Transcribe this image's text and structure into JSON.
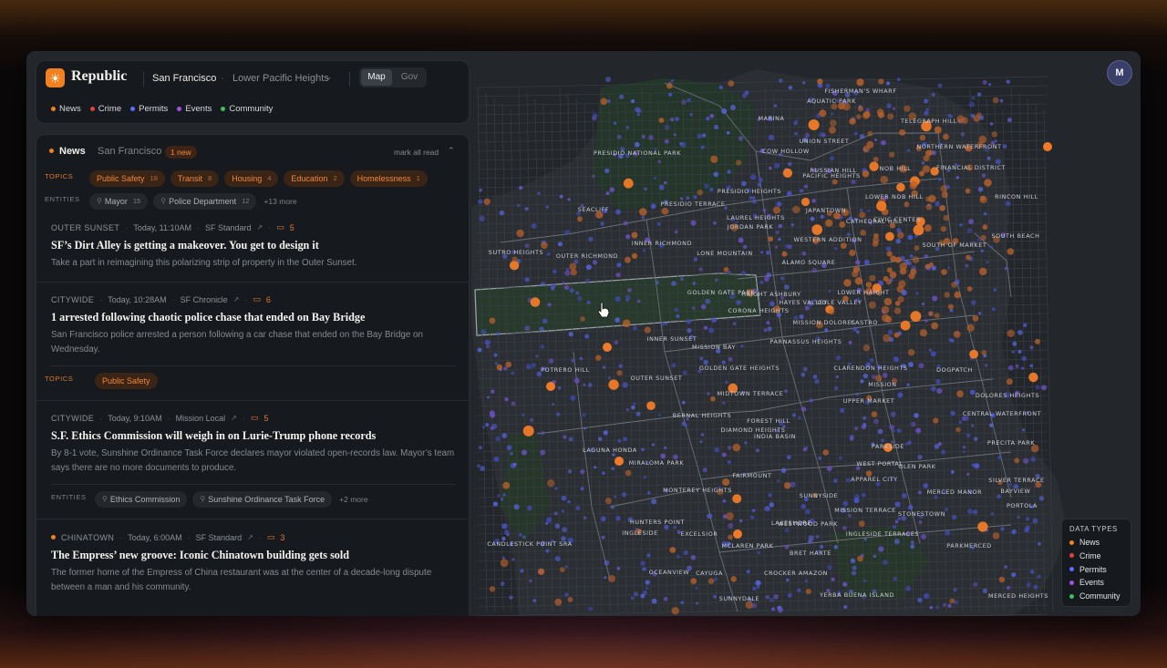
{
  "header": {
    "brand": "Republic",
    "city": "San Francisco",
    "neighborhood": "Lower Pacific Heights",
    "view_tabs": [
      "Map",
      "Gov"
    ],
    "active_tab": "Map",
    "filters": [
      {
        "label": "News",
        "color": "#f08020"
      },
      {
        "label": "Crime",
        "color": "#e04040"
      },
      {
        "label": "Permits",
        "color": "#5a6cff"
      },
      {
        "label": "Events",
        "color": "#a050e8"
      },
      {
        "label": "Community",
        "color": "#3cc060"
      }
    ]
  },
  "feed": {
    "title": "News",
    "city": "San Francisco",
    "new_badge": "1 new",
    "mark_all_read": "mark all read",
    "topics_label": "TOPICS",
    "entities_label": "ENTITIES",
    "topics": [
      {
        "label": "Public Safety",
        "count": "18"
      },
      {
        "label": "Transit",
        "count": "8"
      },
      {
        "label": "Housing",
        "count": "4"
      },
      {
        "label": "Education",
        "count": "2"
      },
      {
        "label": "Homelessness",
        "count": "1"
      }
    ],
    "entities": [
      {
        "label": "Mayor",
        "count": "15"
      },
      {
        "label": "Police Department",
        "count": "12"
      }
    ],
    "entities_more": "+13 more",
    "articles": [
      {
        "location": "OUTER SUNSET",
        "time": "Today, 11:10AM",
        "source": "SF Standard",
        "comments": "5",
        "headline": "SF’s Dirt Alley is getting a makeover. You get to design it",
        "description": "Take a part in reimagining this polarizing strip of property in the Outer Sunset."
      },
      {
        "location": "CITYWIDE",
        "time": "Today, 10:28AM",
        "source": "SF Chronicle",
        "comments": "6",
        "headline": "1 arrested following chaotic police chase that ended on Bay Bridge",
        "description": "San Francisco police arrested a person following a car chase that ended on the Bay Bridge on Wednesday.",
        "topics_label": "TOPICS",
        "topics": [
          "Public Safety"
        ]
      },
      {
        "location": "CITYWIDE",
        "time": "Today, 9:10AM",
        "source": "Mission Local",
        "comments": "5",
        "headline": "S.F. Ethics Commission will weigh in on Lurie-Trump phone records",
        "description": "By 8-1 vote, Sunshine Ordinance Task Force declares mayor violated open-records law. Mayor’s team says there are no more documents to produce.",
        "entities_label": "ENTITIES",
        "entities": [
          "Ethics Commission",
          "Sunshine Ordinance Task Force"
        ],
        "entities_more": "+2 more"
      },
      {
        "location": "CHINATOWN",
        "time": "Today, 6:00AM",
        "source": "SF Standard",
        "comments": "3",
        "headline": "The Empress’ new groove: Iconic Chinatown building gets sold",
        "description": "The former home of the Empress of China restaurant was at the center of a decade-long dispute between a man and his community."
      }
    ]
  },
  "map": {
    "neighborhoods": [
      "FISHERMAN'S WHARF",
      "AQUATIC PARK",
      "TELEGRAPH HILL",
      "MARINA",
      "PRESIDIO NATIONAL PARK",
      "COW HOLLOW",
      "UNION STREET",
      "NORTHERN WATERFRONT",
      "RUSSIAN HILL",
      "NOB HILL",
      "FINANCIAL DISTRICT",
      "PACIFIC HEIGHTS",
      "SEACLIFF",
      "PRESIDIO TERRACE",
      "PRESIDIO HEIGHTS",
      "LAUREL HEIGHTS",
      "JORDAN PARK",
      "JAPANTOWN",
      "CATHEDRAL HILL",
      "LOWER NOB HILL",
      "CIVIC CENTER",
      "RINCON HILL",
      "SOUTH BEACH",
      "SUTRO HEIGHTS",
      "OUTER RICHMOND",
      "INNER RICHMOND",
      "LONE MOUNTAIN",
      "WESTERN ADDITION",
      "SOUTH OF MARKET",
      "ALAMO SQUARE",
      "GOLDEN GATE PARK",
      "HAIGHT ASHBURY",
      "LOWER HAIGHT",
      "HAYES VALLEY",
      "COLE VALLEY",
      "CORONA HEIGHTS",
      "MISSION DOLORES",
      "CASTRO",
      "INNER SUNSET",
      "PARNASSUS HEIGHTS",
      "MISSION BAY",
      "DOGPATCH",
      "POTRERO HILL",
      "OUTER SUNSET",
      "GOLDEN GATE HEIGHTS",
      "CLARENDON HEIGHTS",
      "DOLORES HEIGHTS",
      "MIDTOWN TERRACE",
      "UPPER MARKET",
      "MISSION",
      "CENTRAL WATERFRONT",
      "FOREST HILL",
      "DIAMOND HEIGHTS",
      "BERNAL HEIGHTS",
      "PRECITA PARK",
      "INDIA BASIN",
      "PARKSIDE",
      "WEST PORTAL",
      "LAGUNA HONDA",
      "MIRALOMA PARK",
      "GLEN PARK",
      "FAIRMOUNT",
      "APPAREL CITY",
      "SILVER TERRACE",
      "BAYVIEW",
      "MERCED MANOR",
      "MONTEREY HEIGHTS",
      "SUNNYSIDE",
      "STONESTOWN",
      "WESTWOOD PARK",
      "MISSION TERRACE",
      "PORTOLA",
      "HUNTERS POINT",
      "LAKESHORE",
      "INGLESIDE TERRACES",
      "INGLESIDE",
      "EXCELSIOR",
      "MCLAREN PARK",
      "BRET HARTE",
      "PARKMERCED",
      "CANDLESTICK POINT SRA",
      "MERCED HEIGHTS",
      "OCEANVIEW",
      "CAYUGA",
      "CROCKER AMAZON",
      "SUNNYDALE",
      "YERBA BUENA ISLAND"
    ]
  },
  "legend": {
    "title": "DATA TYPES",
    "items": [
      {
        "label": "News",
        "color": "#f08020"
      },
      {
        "label": "Crime",
        "color": "#e04040"
      },
      {
        "label": "Permits",
        "color": "#5a6cff"
      },
      {
        "label": "Events",
        "color": "#a050e8"
      },
      {
        "label": "Community",
        "color": "#3cc060"
      }
    ]
  },
  "user": {
    "avatar_initial": "M"
  }
}
